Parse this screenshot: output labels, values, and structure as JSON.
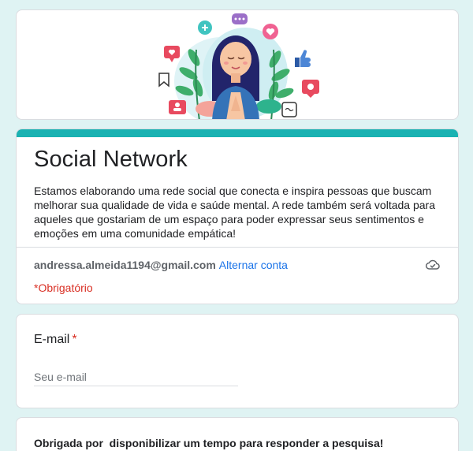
{
  "form": {
    "title": "Social Network",
    "description": "Estamos elaborando uma rede social que conecta e inspira pessoas que buscam melhorar sua qualidade de vida e saúde mental. A rede também será voltada para aqueles que gostariam de um espaço para poder expressar seus sentimentos e emoções em uma comunidade empática!",
    "account_email": "andressa.almeida1194@gmail.com",
    "switch_account_label": "Alternar conta",
    "required_note": "*Obrigatório",
    "accent_color": "#1ab2b2",
    "icons": {
      "banner": "woman-meditating-social-icons-illustration",
      "cloud": "cloud-saved-icon"
    }
  },
  "question_email": {
    "label": "E-mail",
    "required_mark": "*",
    "placeholder": "Seu e-mail",
    "value": ""
  },
  "thanks": {
    "text": "Obrigada por  disponibilizar um tempo para responder a pesquisa!"
  }
}
